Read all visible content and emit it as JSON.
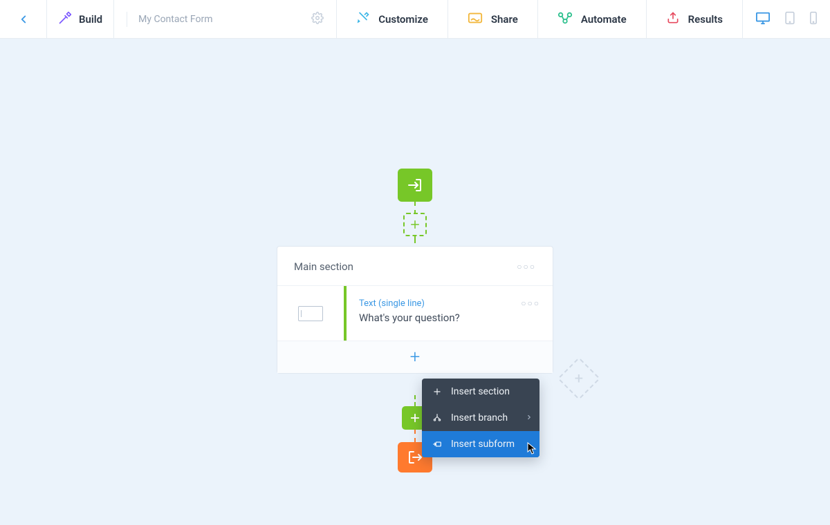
{
  "nav": {
    "build": "Build",
    "form_name": "My Contact Form",
    "customize": "Customize",
    "share": "Share",
    "automate": "Automate",
    "results": "Results"
  },
  "section": {
    "title": "Main section",
    "field": {
      "type": "Text (single line)",
      "label": "What's your question?"
    }
  },
  "menu": {
    "insert_section": "Insert section",
    "insert_branch": "Insert branch",
    "insert_subform": "Insert subform"
  }
}
